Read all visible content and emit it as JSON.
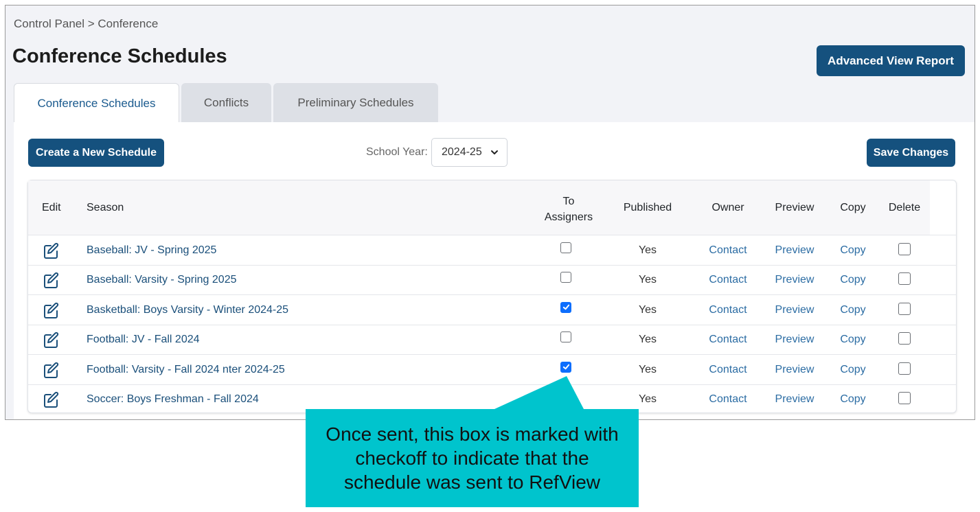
{
  "breadcrumb": "Control Panel > Conference",
  "page_title": "Conference Schedules",
  "advanced_button": "Advanced View Report",
  "tabs": [
    {
      "label": "Conference Schedules",
      "active": true
    },
    {
      "label": "Conflicts",
      "active": false
    },
    {
      "label": "Preliminary Schedules",
      "active": false
    }
  ],
  "create_button": "Create a New Schedule",
  "school_year": {
    "label": "School Year:",
    "value": "2024-25"
  },
  "save_button": "Save Changes",
  "columns": {
    "edit": "Edit",
    "season": "Season",
    "to_assigners_1": "To",
    "to_assigners_2": "Assigners",
    "published": "Published",
    "owner": "Owner",
    "preview": "Preview",
    "copy": "Copy",
    "delete": "Delete"
  },
  "rows": [
    {
      "season": "Baseball: JV - Spring 2025",
      "to_assigners": false,
      "published": "Yes",
      "owner": "Contact",
      "preview": "Preview",
      "copy": "Copy",
      "delete": false
    },
    {
      "season": "Baseball: Varsity - Spring 2025",
      "to_assigners": false,
      "published": "Yes",
      "owner": "Contact",
      "preview": "Preview",
      "copy": "Copy",
      "delete": false
    },
    {
      "season": "Basketball: Boys Varsity - Winter 2024-25",
      "to_assigners": true,
      "published": "Yes",
      "owner": "Contact",
      "preview": "Preview",
      "copy": "Copy",
      "delete": false
    },
    {
      "season": "Football: JV - Fall 2024",
      "to_assigners": false,
      "published": "Yes",
      "owner": "Contact",
      "preview": "Preview",
      "copy": "Copy",
      "delete": false
    },
    {
      "season": "Football: Varsity - Fall 2024   nter 2024-25",
      "to_assigners": true,
      "published": "Yes",
      "owner": "Contact",
      "preview": "Preview",
      "copy": "Copy",
      "delete": false
    },
    {
      "season": "Soccer: Boys Freshman - Fall 2024",
      "to_assigners": null,
      "published": "Yes",
      "owner": "Contact",
      "preview": "Preview",
      "copy": "Copy",
      "delete": false
    }
  ],
  "callout": "Once sent, this box is marked with checkoff to indicate that the schedule was sent to RefView",
  "colors": {
    "primary": "#15517e",
    "link": "#2b6ca3",
    "checked": "#0d6efd",
    "callout": "#00c4cd"
  },
  "icons": {
    "edit": "edit-icon",
    "dropdown": "chevron-down-icon"
  }
}
